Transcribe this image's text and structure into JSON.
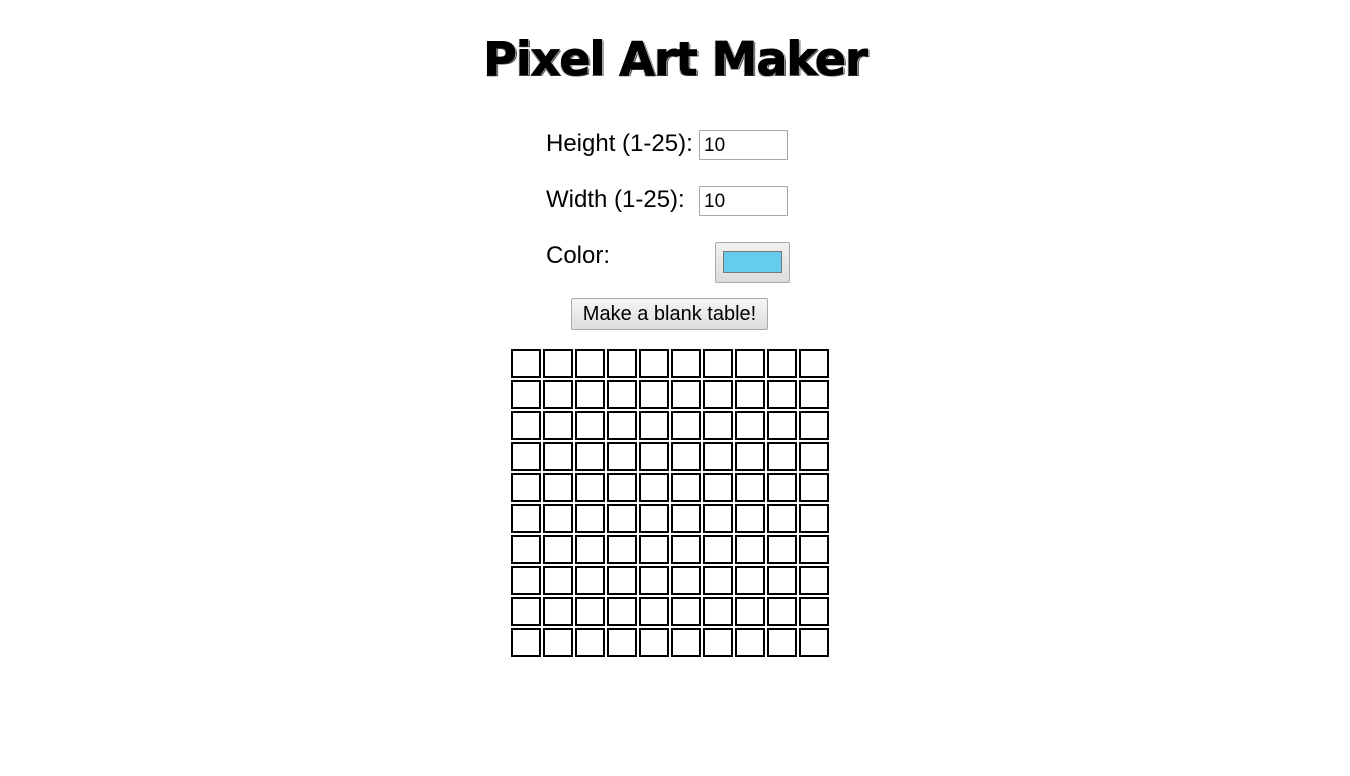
{
  "app": {
    "title": "Pixel Art Maker"
  },
  "form": {
    "height_label": "Height (1-25):",
    "height_value": "10",
    "width_label": "Width (1-25):",
    "width_value": "10",
    "color_label": "Color:",
    "color_value": "#66ccee"
  },
  "button": {
    "make_table_label": "Make a blank table!"
  },
  "grid": {
    "rows": 10,
    "columns": 10,
    "cell_color": "#ffffff",
    "border_color": "#000000"
  }
}
